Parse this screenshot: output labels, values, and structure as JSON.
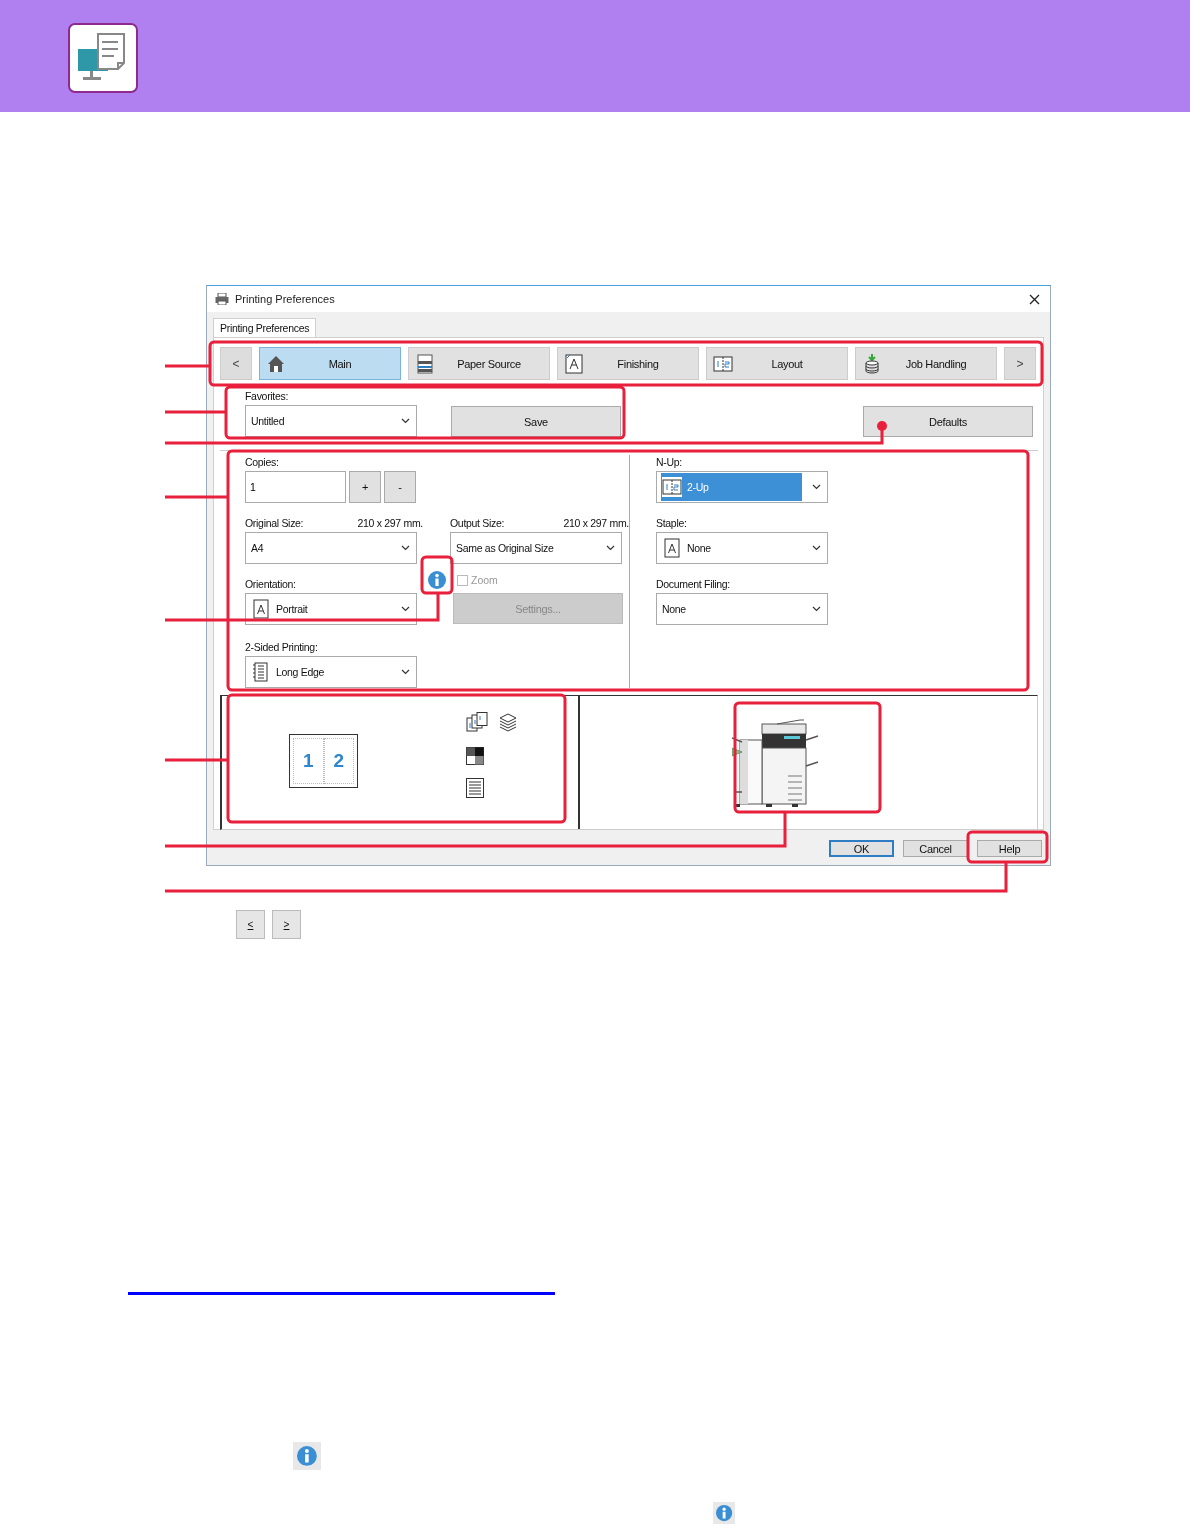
{
  "dialog": {
    "title": "Printing Preferences"
  },
  "sheet_tab": {
    "label": "Printing Preferences",
    "selected": true
  },
  "nav_prev": "<",
  "nav_tabs": [
    {
      "label": "Main",
      "kind": "home",
      "selected": true
    },
    {
      "label": "Paper Source",
      "kind": "paper",
      "selected": false
    },
    {
      "label": "Finishing",
      "kind": "finishing",
      "selected": false
    },
    {
      "label": "Layout",
      "kind": "layout",
      "selected": false
    },
    {
      "label": "Job Handling",
      "kind": "job",
      "selected": false
    }
  ],
  "nav_next": ">",
  "favorites": {
    "label": "Favorites:",
    "value": "Untitled"
  },
  "save_button": "Save",
  "defaults_button": "Defaults",
  "copies": {
    "label": "Copies:",
    "value": "1",
    "increment": "+",
    "decrement": "-"
  },
  "original_size": {
    "label": "Original Size:",
    "dimensions": "210 x 297 mm.",
    "value": "A4"
  },
  "output_size": {
    "label": "Output Size:",
    "dimensions": "210 x 297 mm.",
    "value": "Same as Original Size"
  },
  "orientation": {
    "label": "Orientation:",
    "value": "Portrait"
  },
  "zoom": {
    "label": "Zoom",
    "checked": false,
    "disabled": true
  },
  "settings_button": {
    "label": "Settings...",
    "disabled": true
  },
  "two_sided": {
    "label": "2-Sided Printing:",
    "value": "Long Edge"
  },
  "n_up": {
    "label": "N-Up:",
    "value": "2-Up",
    "highlighted": true
  },
  "staple": {
    "label": "Staple:",
    "value": "None"
  },
  "document_filing": {
    "label": "Document Filing:",
    "value": "None"
  },
  "preview": {
    "page_numbers": [
      "1",
      "2"
    ]
  },
  "buttons": [
    {
      "label": "OK",
      "default": true
    },
    {
      "label": "Cancel",
      "default": false
    },
    {
      "label": "Help",
      "default": false
    }
  ],
  "page_nav": [
    "<",
    ">"
  ]
}
